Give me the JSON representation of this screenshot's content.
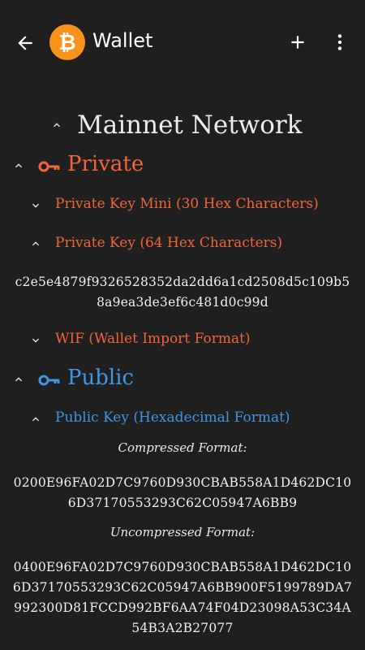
{
  "appbar": {
    "title": "Wallet",
    "logo_glyph": "₿"
  },
  "network": {
    "title": "Mainnet Network"
  },
  "private": {
    "label": "Private",
    "items": {
      "mini": "Private Key Mini (30 Hex Characters)",
      "hex": "Private Key (64 Hex Characters)",
      "hex_value_line1": "c2e5e4879f9326528352da2dd6a1cd2508d5c109b5",
      "hex_value_line2": "8a9ea3de3ef6c481d0c99d",
      "wif": "WIF (Wallet Import Format)"
    }
  },
  "public": {
    "label": "Public",
    "items": {
      "hex": "Public Key (Hexadecimal Format)",
      "compressed_caption": "Compressed Format:",
      "compressed_line1": "0200E96FA02D7C9760D930CBAB558A1D462DC10",
      "compressed_line2": "6D37170553293C62C05947A6BB9",
      "uncompressed_caption": "Uncompressed Format:",
      "uncompressed_line1": "0400E96FA02D7C9760D930CBAB558A1D462DC10",
      "uncompressed_line2": "6D37170553293C62C05947A6BB900F5199789DA7",
      "uncompressed_line3": "992300D81FCCD992BF6AA74F04D23098A53C34A",
      "uncompressed_line4": "54B3A2B27077"
    }
  },
  "colors": {
    "background": "#1f1f1f",
    "orange": "#f2643a",
    "blue": "#3f96e4",
    "bitcoin": "#f7931a"
  },
  "icons": [
    "arrow-back-icon",
    "bitcoin-logo",
    "plus-icon",
    "more-vert-icon",
    "chevron-up-icon",
    "chevron-down-icon",
    "key-icon"
  ]
}
